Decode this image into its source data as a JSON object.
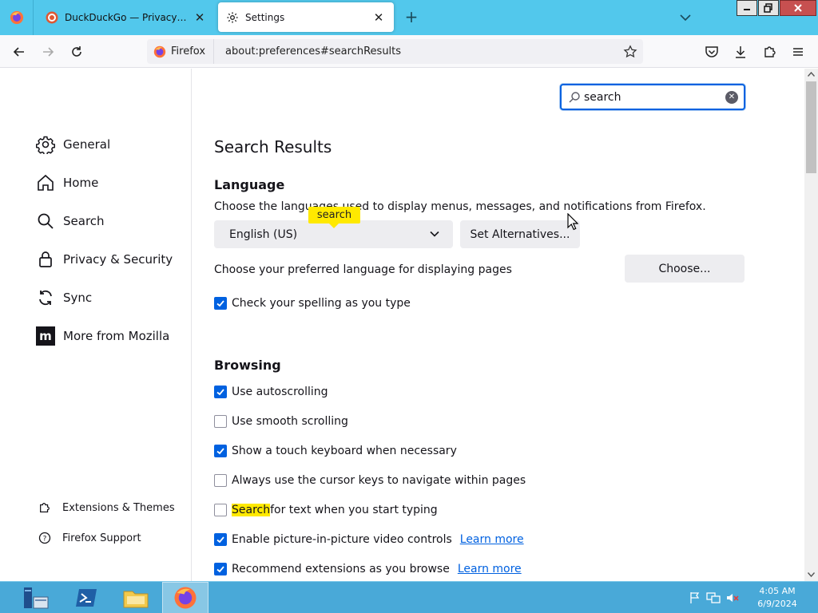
{
  "browser": {
    "tabs": [
      {
        "title": "DuckDuckGo — Privacy, simplified.",
        "active": false,
        "icon": "duckduckgo-icon"
      },
      {
        "title": "Settings",
        "active": true,
        "icon": "gear-icon"
      }
    ],
    "identity_label": "Firefox",
    "url": "about:preferences#searchResults"
  },
  "sidebar": {
    "categories": [
      {
        "label": "General",
        "icon": "gear-icon"
      },
      {
        "label": "Home",
        "icon": "home-icon"
      },
      {
        "label": "Search",
        "icon": "search-icon"
      },
      {
        "label": "Privacy & Security",
        "icon": "lock-icon"
      },
      {
        "label": "Sync",
        "icon": "sync-icon"
      },
      {
        "label": "More from Mozilla",
        "icon": "mozilla-icon"
      }
    ],
    "footer_links": [
      {
        "label": "Extensions & Themes",
        "icon": "puzzle-icon"
      },
      {
        "label": "Firefox Support",
        "icon": "help-icon"
      }
    ]
  },
  "main": {
    "search_value": "search",
    "heading": "Search Results",
    "tooltip": "search",
    "language": {
      "title": "Language",
      "description": "Choose the languages used to display menus, messages, and notifications from Firefox.",
      "selected_language": "English (US)",
      "set_alternatives": "Set Alternatives...",
      "pages_description": "Choose your preferred language for displaying pages",
      "choose": "Choose...",
      "spellcheck": {
        "label": "Check your spelling as you type",
        "checked": true
      }
    },
    "browsing": {
      "title": "Browsing",
      "options": [
        {
          "label": "Use autoscrolling",
          "checked": true
        },
        {
          "label": "Use smooth scrolling",
          "checked": false
        },
        {
          "label": "Show a touch keyboard when necessary",
          "checked": true
        },
        {
          "label": "Always use the cursor keys to navigate within pages",
          "checked": false
        },
        {
          "label_highlight": "Search",
          "label_rest": " for text when you start typing",
          "checked": false
        },
        {
          "label": "Enable picture-in-picture video controls",
          "checked": true,
          "link": "Learn more"
        },
        {
          "label": "Recommend extensions as you browse",
          "checked": true,
          "link": "Learn more"
        }
      ]
    }
  },
  "taskbar": {
    "time": "4:05 AM",
    "date": "6/9/2024"
  },
  "colors": {
    "tabstrip": "#52c8ec",
    "accent": "#0061e0",
    "highlight": "#ffe900",
    "taskbar": "#49a9d8"
  }
}
